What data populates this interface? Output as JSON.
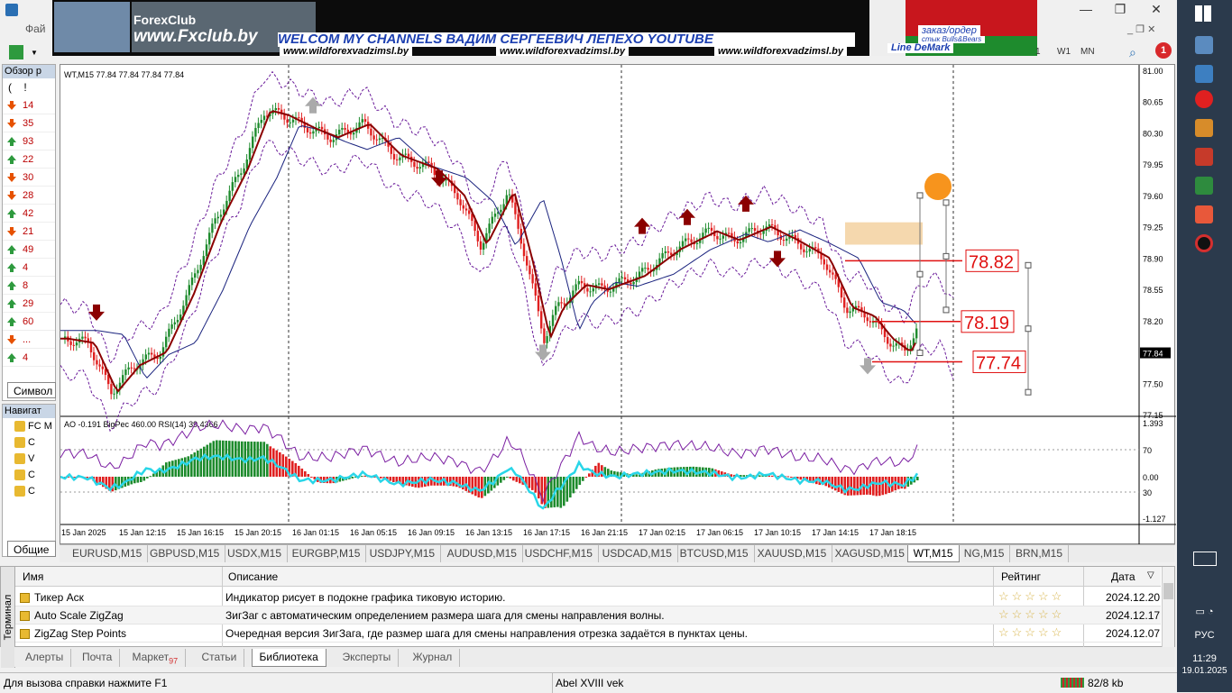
{
  "window": {
    "menu_file": "Фай",
    "min": "—",
    "restore": "❐",
    "close": "✕"
  },
  "banner": {
    "logo": "ForexClub",
    "site": "www.Fxclub.by",
    "welcome": "WELCOM MY CHANNELS ВАДИМ СЕРГЕЕВИЧ ЛЕПЕХО YOUTUBE",
    "url1": "www.wildforexvadzimsl.by",
    "url2": "www.wildforexvadzimsl.by",
    "url3": "www.wildforexvadzimsl.by",
    "order": "заказ/ордер",
    "order2": "стык Bulls&Bears",
    "order3": "Line DeMark"
  },
  "toolbar": {
    "tf_w1": "W1",
    "tf_mn": "MN",
    "tf_1": "1",
    "notifications": "1"
  },
  "market_watch": {
    "title": "Обзор р",
    "col1": "(",
    "col2": "!",
    "rows": [
      {
        "v": "14",
        "dir": "down"
      },
      {
        "v": "35",
        "dir": "down"
      },
      {
        "v": "93",
        "dir": "up"
      },
      {
        "v": "22",
        "dir": "up"
      },
      {
        "v": "30",
        "dir": "down"
      },
      {
        "v": "28",
        "dir": "down"
      },
      {
        "v": "42",
        "dir": "up"
      },
      {
        "v": "21",
        "dir": "down"
      },
      {
        "v": "49",
        "dir": "up"
      },
      {
        "v": "4",
        "dir": "up"
      },
      {
        "v": "8",
        "dir": "up"
      },
      {
        "v": "29",
        "dir": "up"
      },
      {
        "v": "60",
        "dir": "up"
      },
      {
        "v": "...",
        "dir": "down"
      },
      {
        "v": "4",
        "dir": "up"
      }
    ],
    "tab": "Символ"
  },
  "navigator": {
    "title": "Навигат",
    "items": [
      "FC M",
      "С",
      "V",
      "С",
      "С"
    ],
    "tab": "Общие"
  },
  "chart": {
    "header": "WT,M15  77.84 77.84 77.84 77.84",
    "indicator_header": "AO -0.191  BigPec 460.00  RSI(14) 39.4366",
    "price_ticks": [
      "81.00",
      "80.65",
      "80.30",
      "79.95",
      "79.60",
      "79.25",
      "78.90",
      "78.55",
      "78.20",
      "77.84",
      "77.50",
      "77.15"
    ],
    "current_price": "77.84",
    "osc_ticks": [
      "1.393",
      "70",
      "0.00",
      "30",
      "-1.127"
    ],
    "time_ticks": [
      "15 Jan 2025",
      "15 Jan 12:15",
      "15 Jan 16:15",
      "15 Jan 20:15",
      "16 Jan 01:15",
      "16 Jan 05:15",
      "16 Jan 09:15",
      "16 Jan 13:15",
      "16 Jan 17:15",
      "16 Jan 21:15",
      "17 Jan 02:15",
      "17 Jan 06:15",
      "17 Jan 10:15",
      "17 Jan 14:15",
      "17 Jan 18:15"
    ],
    "levels": {
      "l1": "78.82",
      "l2": "78.19",
      "l3": "77.74"
    },
    "colors": {
      "bull": "#1e8b2d",
      "bear": "#e02020",
      "ma": "#8b0000",
      "ma2": "#1a237e",
      "env": "#6a1b9a",
      "rsi": "#7b1fa2",
      "ao_line": "#29d6e8",
      "level": "#e01010"
    }
  },
  "symbol_tabs": [
    "EURUSD,M15",
    "GBPUSD,M15",
    "USDX,M15",
    "EURGBP,M15",
    "USDJPY,M15",
    "AUDUSD,M15",
    "USDCHF,M15",
    "USDCAD,M15",
    "BTCUSD,M15",
    "XAUUSD,M15",
    "XAGUSD,M15",
    "WT,M15",
    "NG,M15",
    "BRN,M15"
  ],
  "active_symbol_tab": "WT,M15",
  "library": {
    "terminal_label": "Терминал",
    "headers": {
      "name": "Имя",
      "desc": "Описание",
      "rating": "Рейтинг",
      "date": "Дата"
    },
    "rows": [
      {
        "name": "Тикер Аск",
        "desc": "Индикатор рисует в подокне графика тиковую историю.",
        "rating": "☆☆☆☆☆",
        "date": "2024.12.20"
      },
      {
        "name": "Auto Scale ZigZag",
        "desc": "ЗигЗаг с автоматическим определением размера шага для смены направления волны.",
        "rating": "☆☆☆☆☆",
        "date": "2024.12.17"
      },
      {
        "name": "ZigZag Step Points",
        "desc": "Очередная версия ЗигЗага, где размер шага для смены направления отрезка задаётся в пунктах цены.",
        "rating": "☆☆☆☆☆",
        "date": "2024.12.07"
      }
    ]
  },
  "terminal_tabs": [
    {
      "label": "Алерты"
    },
    {
      "label": "Почта"
    },
    {
      "label": "Маркет",
      "badge": "97"
    },
    {
      "label": "Статьи"
    },
    {
      "label": "Библиотека",
      "active": true
    },
    {
      "label": "Эксперты"
    },
    {
      "label": "Журнал"
    }
  ],
  "status": {
    "help": "Для вызова справки нажмите F1",
    "profile": "Abel XVIII vek",
    "traffic": "82/8 kb"
  },
  "tray": {
    "lang": "РУС",
    "time": "11:29",
    "date": "19.01.2025"
  }
}
